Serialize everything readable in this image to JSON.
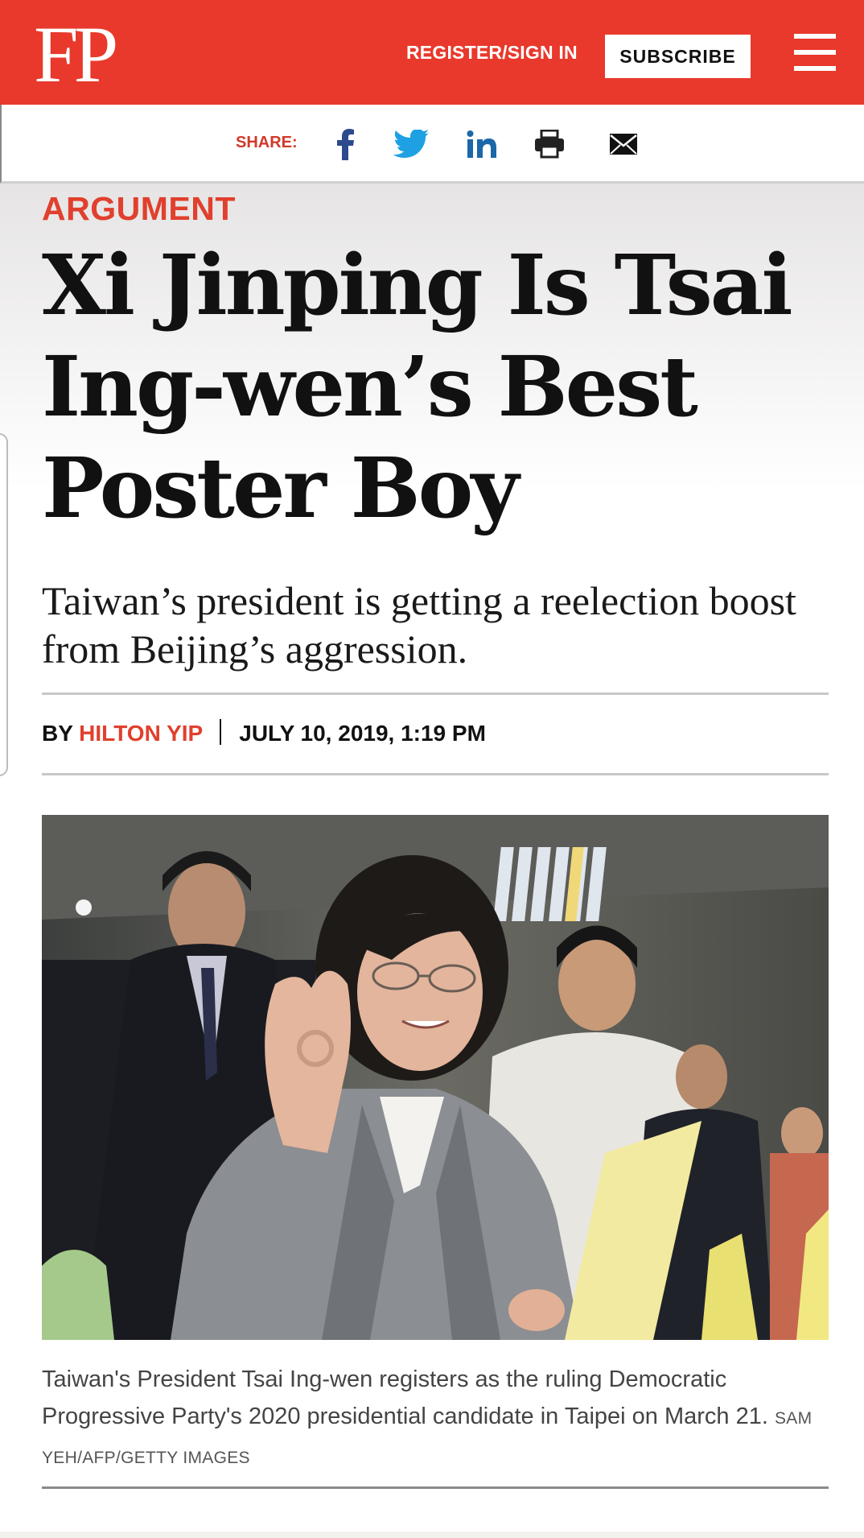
{
  "header": {
    "logo": "FP",
    "register_label": "REGISTER/SIGN IN",
    "subscribe_label": "SUBSCRIBE",
    "menu_icon": "hamburger-menu-icon",
    "background_color": "#e8392c"
  },
  "share": {
    "label": "SHARE:",
    "icons": [
      "facebook-icon",
      "twitter-icon",
      "linkedin-icon",
      "print-icon",
      "email-icon"
    ]
  },
  "article": {
    "section": "ARGUMENT",
    "headline_lines": [
      "Xi Jinping Is Tsai",
      "Ing-wen’s Best",
      "Poster Boy"
    ],
    "dek_lines": [
      "Taiwan’s president is getting a reelection boost",
      "from Beijing’s aggression."
    ],
    "by": "BY",
    "author": "HILTON YIP",
    "date": "JULY 10, 2019, 1:19 PM"
  },
  "photo": {
    "caption_lines": [
      "Taiwan's President Tsai Ing-wen registers as the ruling Democratic",
      "Progressive Party's 2020 presidential candidate in Taipei on March 21."
    ],
    "credit_part1": "SAM",
    "credit_part2": "YEH/AFP/GETTY IMAGES"
  },
  "colors": {
    "accent": "#e0402d",
    "text": "#111111"
  }
}
